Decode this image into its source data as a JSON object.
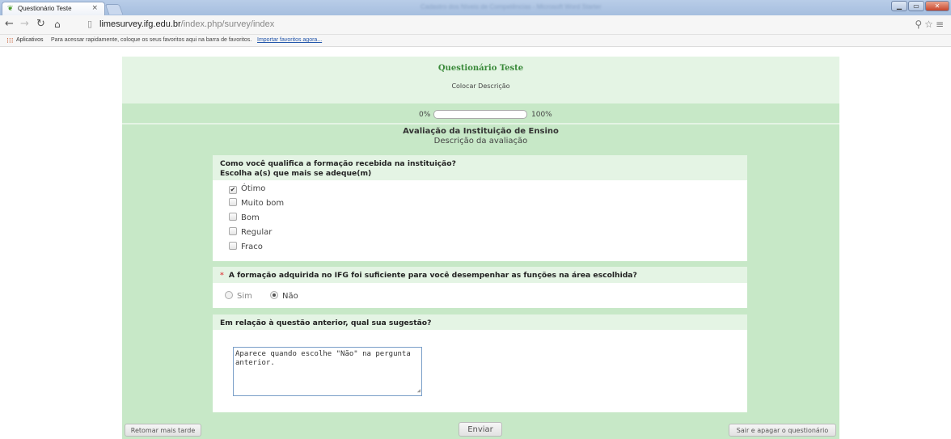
{
  "browser": {
    "tab_title": "Questionário Teste",
    "tab_close": "×",
    "window_caption": "Cadastro dos Níveis de Competências - Microsoft Word Starter",
    "url_host": "limesurvey.ifg.edu.br",
    "url_path": "/index.php/survey/index",
    "bookmarks": {
      "apps_label": "Aplicativos",
      "hint": "Para acessar rapidamente, coloque os seus favoritos aqui na barra de favoritos.",
      "import_link": "Importar favoritos agora..."
    }
  },
  "survey": {
    "title": "Questionário Teste",
    "description": "Colocar Descrição",
    "progress": {
      "min_label": "0%",
      "max_label": "100%",
      "value_fraction": 0.0
    },
    "group": {
      "title": "Avaliação da Instituição de Ensino",
      "description": "Descrição da avaliação"
    },
    "questions": [
      {
        "text": "Como você qualifica a formação recebida na instituição?",
        "help": "Escolha a(s) que mais se adeque(m)",
        "options": [
          {
            "label": "Ótimo",
            "checked": true
          },
          {
            "label": "Muito bom",
            "checked": false
          },
          {
            "label": "Bom",
            "checked": false
          },
          {
            "label": "Regular",
            "checked": false
          },
          {
            "label": "Fraco",
            "checked": false
          }
        ]
      },
      {
        "mandatory_marker": "*",
        "text": "A formação adquirida no IFG foi suficiente para você desempenhar as funções na área escolhida?",
        "options": [
          {
            "label": "Sim",
            "selected": false
          },
          {
            "label": "Não",
            "selected": true
          }
        ]
      },
      {
        "text": "Em relação à questão anterior, qual sua sugestão?",
        "answer": "Aparece quando escolhe \"Não\" na pergunta anterior."
      }
    ],
    "buttons": {
      "resume_later": "Retomar mais tarde",
      "submit": "Enviar",
      "clear_exit": "Sair e apagar o questionário"
    }
  },
  "colors": {
    "page_bg": "#c7e8c7",
    "header_bg": "#e4f4e4",
    "title_green": "#3a8a3a",
    "mandatory_red": "#e05050"
  }
}
